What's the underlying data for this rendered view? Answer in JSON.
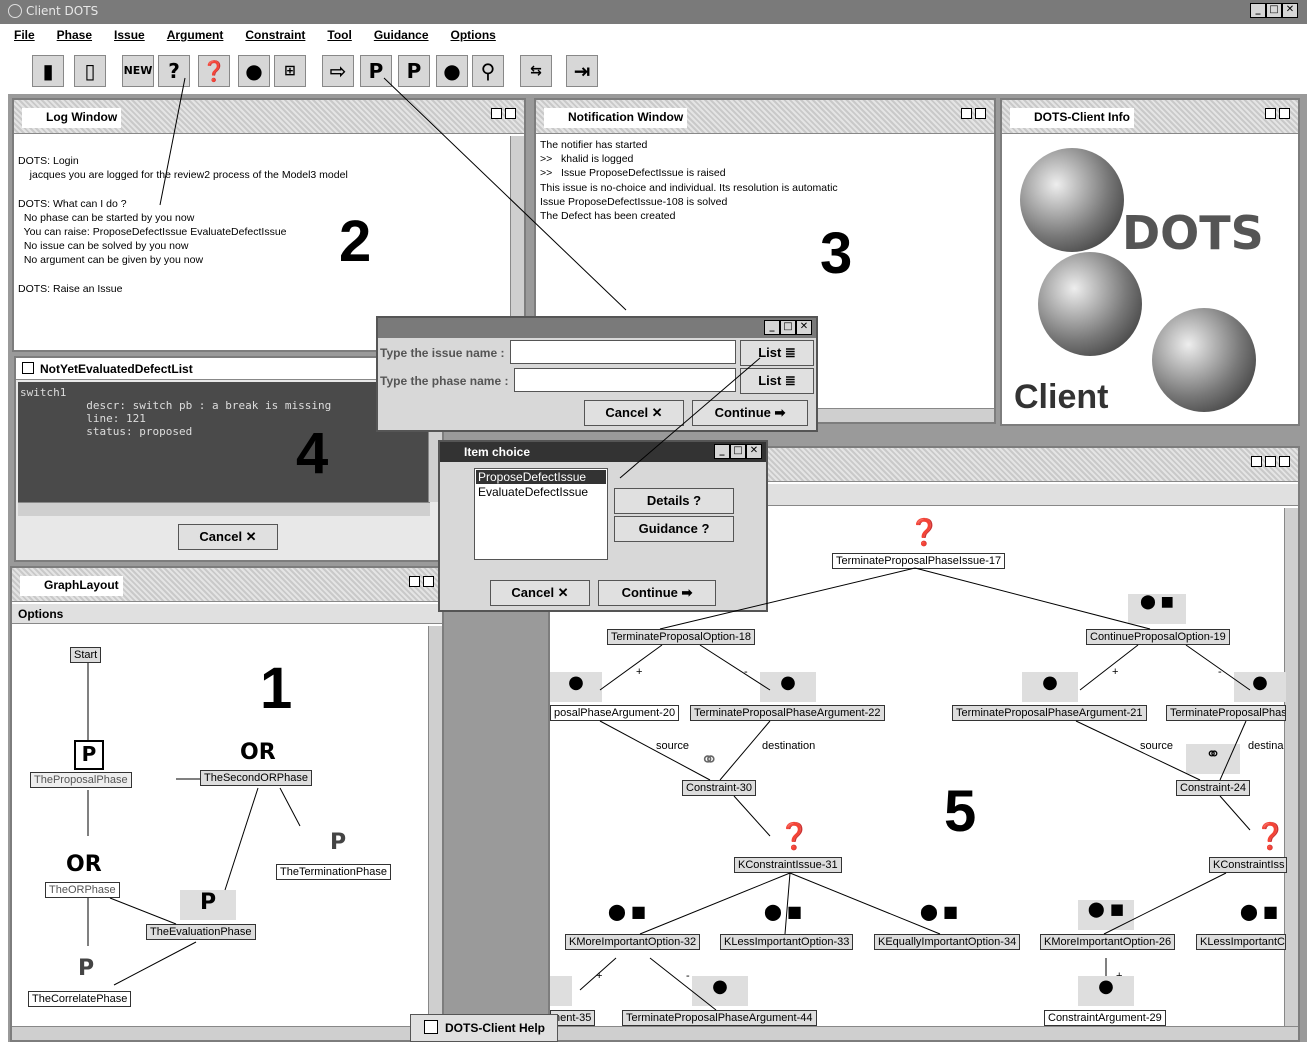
{
  "app": {
    "title": "Client DOTS"
  },
  "menu": [
    "File",
    "Phase",
    "Issue",
    "Argument",
    "Constraint",
    "Tool",
    "Guidance",
    "Options"
  ],
  "toolbar_icons": [
    "door-icon",
    "new-file-icon",
    "new-book-icon",
    "help-question-icon",
    "issue-icon",
    "argument-icon",
    "tree-icon",
    "arrow-icon",
    "add-issue-icon",
    "remove-issue-icon",
    "add-argument-icon",
    "constraint-link-icon",
    "reorganize-icon",
    "exit-icon"
  ],
  "log": {
    "title": "Log Window",
    "text": "DOTS: Login\n    jacques you are logged for the review2 process of the Model3 model\n\nDOTS: What can I do ?\n  No phase can be started by you now\n  You can raise: ProposeDefectIssue EvaluateDefectIssue\n  No issue can be solved by you now\n  No argument can be given by you now\n\nDOTS: Raise an Issue",
    "number": "2"
  },
  "notification": {
    "title": "Notification Window",
    "text": "The notifier has started\n>>   khalid is logged\n>>   Issue ProposeDefectIssue is raised\nThis issue is no-choice and individual. Its resolution is automatic\nIssue ProposeDefectIssue-108 is solved\nThe Defect has been created",
    "number": "3"
  },
  "info": {
    "title": "DOTS-Client Info",
    "logo_word": "DOTS",
    "client_word": "Client"
  },
  "defect_list": {
    "title": "NotYetEvaluatedDefectList",
    "text": "switch1\n          descr: switch pb : a break is missing\n          line: 121\n          status: proposed",
    "number": "4",
    "cancel": "Cancel ✕"
  },
  "issue_dialog": {
    "issue_label": "Type the issue name :",
    "phase_label": "Type the phase name :",
    "list1": "List ≣",
    "list2": "List ≣",
    "cancel": "Cancel ✕",
    "continue": "Continue ➡"
  },
  "item_choice": {
    "title": "Item choice",
    "items": [
      "ProposeDefectIssue",
      "EvaluateDefectIssue"
    ],
    "details": "Details ?",
    "guidance": "Guidance ?",
    "cancel": "Cancel ✕",
    "continue": "Continue ➡"
  },
  "graph": {
    "title": "GraphLayout",
    "options": "Options",
    "number": "1",
    "start": "Start",
    "proposal": "TheProposalPhase",
    "second_or": "TheSecondORPhase",
    "termination": "TheTerminationPhase",
    "or_phase": "TheORPhase",
    "evaluation": "TheEvaluationPhase",
    "correlate": "TheCorrelatePhase",
    "or1": "OR",
    "or2": "OR",
    "p": "P"
  },
  "tree": {
    "number": "5",
    "nodes": {
      "n17": "TerminateProposalPhaseIssue-17",
      "n18": "TerminateProposalOption-18",
      "n19": "ContinueProposalOption-19",
      "n20": "posalPhaseArgument-20",
      "n22": "TerminateProposalPhaseArgument-22",
      "n21": "TerminateProposalPhaseArgument-21",
      "n23": "TerminateProposalPhas",
      "n30": "Constraint-30",
      "n24": "Constraint-24",
      "n31": "KConstraintIssue-31",
      "n31b": "KConstraintIss",
      "n32": "KMoreImportantOption-32",
      "n33": "KLessImportantOption-33",
      "n34": "KEquallyImportantOption-34",
      "n26": "KMoreImportantOption-26",
      "n27": "KLessImportantC",
      "n35": "nent-35",
      "n44": "TerminateProposalPhaseArgument-44",
      "n29": "ConstraintArgument-29"
    },
    "source": "source",
    "destination": "destination",
    "destina": "destina",
    "plus": "+",
    "minus": "-"
  },
  "help": {
    "title": "DOTS-Client Help"
  }
}
